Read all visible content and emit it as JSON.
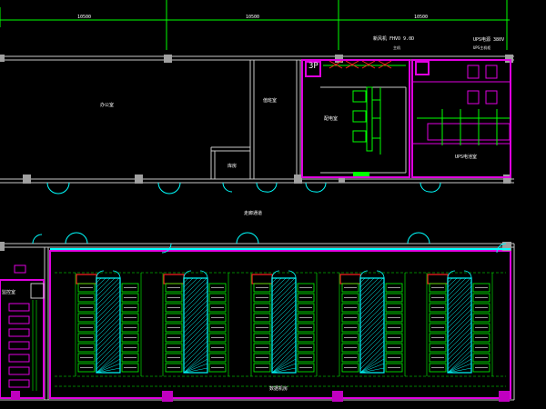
{
  "dimensions": {
    "d1": "10500",
    "d2": "10500",
    "d3": "10500"
  },
  "rooms": {
    "office_left": "办公室",
    "office_mid": "值班室",
    "storage": "库房",
    "corridor": "走廊通道",
    "power_room": "配电室",
    "ups_room": "UPS电池室",
    "datacenter": "数据机房",
    "monitor_room": "监控室",
    "jp_tag": "3P"
  },
  "annotations": {
    "top_note": "新风机 FHVO 9.0D",
    "top_right_note": "UPS电源 380V",
    "top_sub": "主机",
    "right_sub": "UPS主机柜"
  },
  "colors": {
    "wall": "#c8c8c8",
    "magenta": "#e000e0",
    "cyan": "#00ffff",
    "green": "#00ff00",
    "red": "#ff2020",
    "white": "#ffffff"
  }
}
